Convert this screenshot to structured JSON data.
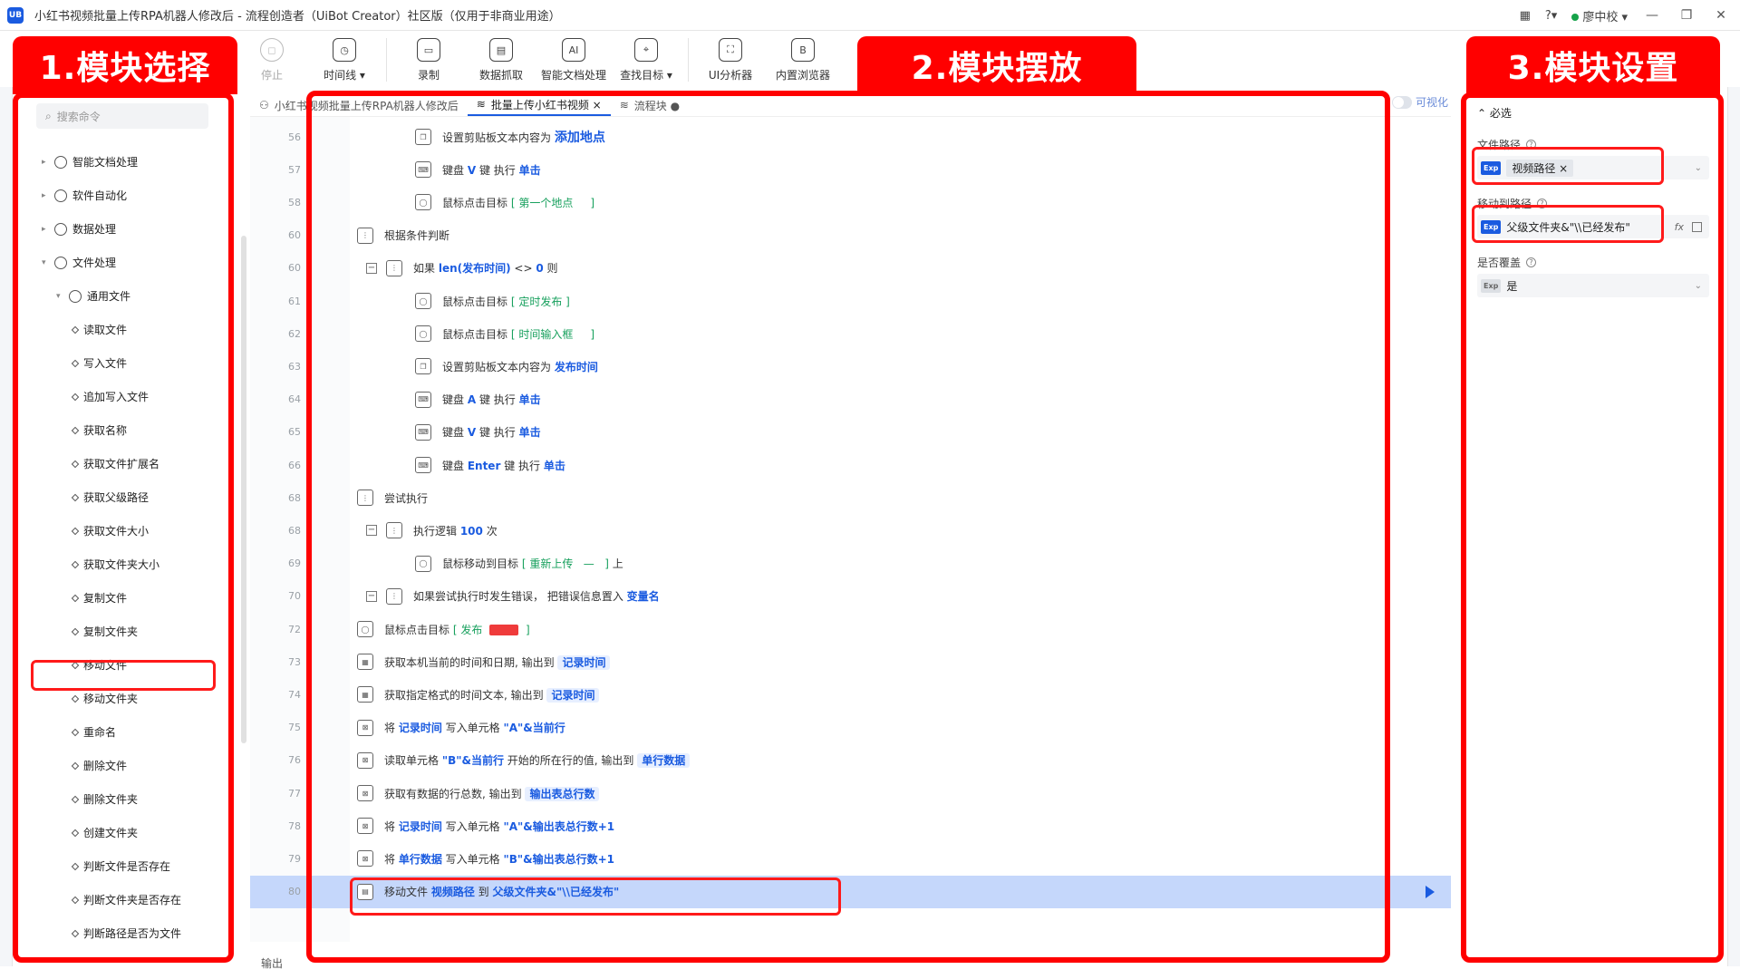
{
  "app": {
    "logo": "UB",
    "title": "小红书视频批量上传RPA机器人修改后 - 流程创造者（UiBot Creator）社区版（仅用于非商业用途）",
    "user": "廖中校"
  },
  "toolbar": [
    {
      "label": "停止",
      "icon": "stop-icon",
      "glyph": "◻",
      "disabled": true
    },
    {
      "label": "时间线 ▾",
      "icon": "clock-icon",
      "glyph": "◷",
      "disabled": false
    },
    {
      "label": "录制",
      "icon": "record-icon",
      "glyph": "▭",
      "disabled": false
    },
    {
      "label": "数据抓取",
      "icon": "data-scrape-icon",
      "glyph": "▤",
      "disabled": false
    },
    {
      "label": "智能文档处理",
      "icon": "ai-doc-icon",
      "glyph": "AI",
      "disabled": false
    },
    {
      "label": "查找目标 ▾",
      "icon": "find-target-icon",
      "glyph": "⌖",
      "disabled": false
    },
    {
      "label": "UI分析器",
      "icon": "ui-analyzer-icon",
      "glyph": "⛶",
      "disabled": false
    },
    {
      "label": "内置浏览器",
      "icon": "browser-icon",
      "glyph": "B",
      "disabled": false
    }
  ],
  "annotations": {
    "a1": "1.模块选择",
    "a2": "2.模块摆放",
    "a3": "3.模块设置"
  },
  "commands": {
    "search_placeholder": "搜索命令",
    "tree": [
      {
        "label": "智能文档处理",
        "level": 0,
        "arrow": "▸"
      },
      {
        "label": "软件自动化",
        "level": 0,
        "arrow": "▸"
      },
      {
        "label": "数据处理",
        "level": 0,
        "arrow": "▸"
      },
      {
        "label": "文件处理",
        "level": 0,
        "arrow": "▾"
      },
      {
        "label": "通用文件",
        "level": 1,
        "arrow": "▾"
      },
      {
        "label": "读取文件",
        "level": 2
      },
      {
        "label": "写入文件",
        "level": 2
      },
      {
        "label": "追加写入文件",
        "level": 2
      },
      {
        "label": "获取名称",
        "level": 2
      },
      {
        "label": "获取文件扩展名",
        "level": 2
      },
      {
        "label": "获取父级路径",
        "level": 2
      },
      {
        "label": "获取文件大小",
        "level": 2
      },
      {
        "label": "获取文件夹大小",
        "level": 2
      },
      {
        "label": "复制文件",
        "level": 2
      },
      {
        "label": "复制文件夹",
        "level": 2
      },
      {
        "label": "移动文件",
        "level": 2
      },
      {
        "label": "移动文件夹",
        "level": 2
      },
      {
        "label": "重命名",
        "level": 2
      },
      {
        "label": "删除文件",
        "level": 2
      },
      {
        "label": "删除文件夹",
        "level": 2
      },
      {
        "label": "创建文件夹",
        "level": 2
      },
      {
        "label": "判断文件是否存在",
        "level": 2
      },
      {
        "label": "判断文件夹是否存在",
        "level": 2
      },
      {
        "label": "判断路径是否为文件",
        "level": 2
      }
    ]
  },
  "editor": {
    "tabs": [
      {
        "label": "小红书视频批量上传RPA机器人修改后",
        "active": false
      },
      {
        "label": "批量上传小红书视频 ×",
        "active": true
      },
      {
        "label": "流程块 ●",
        "active": false
      }
    ],
    "visualize": "可视化",
    "output_label": "输出",
    "rows": [
      {
        "no": "56",
        "indent": 2,
        "text": "设置剪贴板文本内容为 <span class='kw' style='font-size:14px'>添加地点</span>",
        "icon": "clipboard-icon"
      },
      {
        "no": "57",
        "indent": 2,
        "text": "键盘 <span class='kw'>V</span> 键 执行 <span class='kw'>单击</span>",
        "icon": "keyboard-icon"
      },
      {
        "no": "58",
        "indent": 2,
        "text": "鼠标点击目标 <span class='tgt'>[ 第一个地点 &nbsp; &nbsp; ]</span>",
        "icon": "mouse-icon"
      },
      {
        "no": "60",
        "indent": 0,
        "text": "根据条件判断",
        "icon": "condition-icon"
      },
      {
        "no": "60",
        "indent": 1,
        "text": "如果 <span class='kw'>len(发布时间)</span> &lt;&gt; <span class='kw'>0</span> 则",
        "icon": "if-icon",
        "collapse": true
      },
      {
        "no": "61",
        "indent": 2,
        "text": "鼠标点击目标 <span class='tgt'>[ 定时发布 ]</span>",
        "icon": "mouse-icon"
      },
      {
        "no": "62",
        "indent": 2,
        "text": "鼠标点击目标 <span class='tgt'>[ 时间输入框 &nbsp; &nbsp; ]</span>",
        "icon": "mouse-icon"
      },
      {
        "no": "63",
        "indent": 2,
        "text": "设置剪贴板文本内容为 <span class='kw'>发布时间</span>",
        "icon": "clipboard-icon"
      },
      {
        "no": "64",
        "indent": 2,
        "text": "键盘 <span class='kw'>A</span> 键 执行 <span class='kw'>单击</span>",
        "icon": "keyboard-icon"
      },
      {
        "no": "65",
        "indent": 2,
        "text": "键盘 <span class='kw'>V</span> 键 执行 <span class='kw'>单击</span>",
        "icon": "keyboard-icon"
      },
      {
        "no": "66",
        "indent": 2,
        "text": "键盘 <span class='kw'>Enter</span> 键 执行 <span class='kw'>单击</span>",
        "icon": "keyboard-icon"
      },
      {
        "no": "68",
        "indent": 0,
        "text": "尝试执行",
        "icon": "try-icon"
      },
      {
        "no": "68",
        "indent": 1,
        "text": "执行逻辑 <span class='kw'>100</span> 次",
        "icon": "loop-icon",
        "collapse": true
      },
      {
        "no": "69",
        "indent": 2,
        "text": "鼠标移动到目标 <span class='tgt'>[ 重新上传 &nbsp; — &nbsp; ]</span> 上",
        "icon": "mouse-icon"
      },
      {
        "no": "70",
        "indent": 1,
        "text": "如果尝试执行时发生错误， 把错误信息置入 <span class='kw'>变量名</span>",
        "icon": "catch-icon",
        "collapse": true
      },
      {
        "no": "72",
        "indent": 0,
        "text": "鼠标点击目标 <span class='tgt'>[ 发布 <span class='tag-red'></span> ]</span>",
        "icon": "mouse-icon"
      },
      {
        "no": "73",
        "indent": 0,
        "text": "获取本机当前的时间和日期, 输出到 <span class='var-chip'>记录时间</span>",
        "icon": "calendar-icon"
      },
      {
        "no": "74",
        "indent": 0,
        "text": "获取指定格式的时间文本, 输出到 <span class='var-chip'>记录时间</span>",
        "icon": "calendar-icon"
      },
      {
        "no": "75",
        "indent": 0,
        "text": "将 <span class='kw'>记录时间</span> 写入单元格 <span class='kw'>\"A\"&amp;当前行</span>",
        "icon": "excel-icon"
      },
      {
        "no": "76",
        "indent": 0,
        "text": "读取单元格 <span class='kw'>\"B\"&amp;当前行</span> 开始的所在行的值, 输出到 <span class='var-chip'>单行数据</span>",
        "icon": "excel-icon"
      },
      {
        "no": "77",
        "indent": 0,
        "text": "获取有数据的行总数, 输出到 <span class='var-chip'>输出表总行数</span>",
        "icon": "excel-icon"
      },
      {
        "no": "78",
        "indent": 0,
        "text": "将 <span class='kw'>记录时间</span> 写入单元格 <span class='kw'>\"A\"&amp;输出表总行数+1</span>",
        "icon": "excel-icon"
      },
      {
        "no": "79",
        "indent": 0,
        "text": "将 <span class='kw'>单行数据</span> 写入单元格 <span class='kw'>\"B\"&amp;输出表总行数+1</span>",
        "icon": "excel-icon"
      },
      {
        "no": "80",
        "indent": 0,
        "text": "移动文件 <span class='kw'>视频路径</span> 到 <span class='kw'>父级文件夹&amp;\"\\\\已经发布\"</span>",
        "icon": "file-icon",
        "selected": true
      }
    ]
  },
  "props": {
    "section": "⌃ 必选",
    "file_path_label": "文件路径",
    "file_path_value": "视频路径 ×",
    "move_to_label": "移动到路径",
    "move_to_value": "父级文件夹&\"\\\\已经发布\"",
    "overwrite_label": "是否覆盖",
    "overwrite_value": "是",
    "exp": "Exp",
    "fx": "fx"
  },
  "colors": {
    "accent": "#1a5be0",
    "annotation": "#ff0000",
    "selected_row": "#c5d7fb"
  }
}
